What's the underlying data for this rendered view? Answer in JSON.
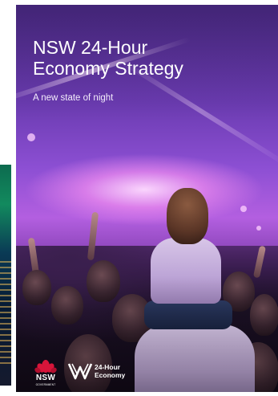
{
  "cover": {
    "title_line1": "NSW 24-Hour",
    "title_line2": "Economy Strategy",
    "subtitle": "A new state of night"
  },
  "logos": {
    "nsw": {
      "name": "NSW",
      "sub": "GOVERNMENT",
      "icon": "waratah-icon"
    },
    "economy": {
      "line1": "24-Hour",
      "line2": "Economy",
      "icon": "wave-mark-icon"
    }
  },
  "colors": {
    "purple_dark": "#4b2a86",
    "purple_glow": "#b35fe0",
    "nsw_red": "#d7153a",
    "text": "#ffffff"
  }
}
